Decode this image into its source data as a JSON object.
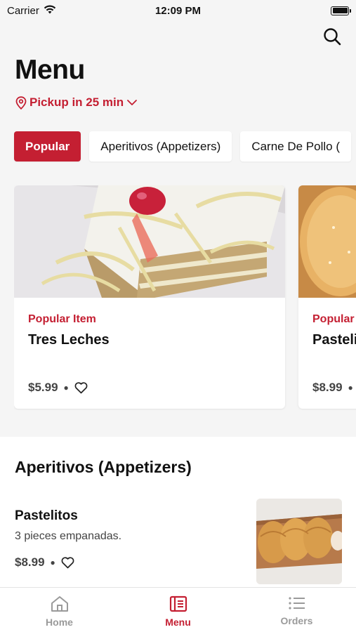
{
  "status_bar": {
    "carrier": "Carrier",
    "time": "12:09 PM"
  },
  "header": {
    "title": "Menu",
    "pickup": "Pickup in 25 min"
  },
  "tabs": [
    {
      "label": "Popular",
      "active": true
    },
    {
      "label": "Aperitivos (Appetizers)",
      "active": false
    },
    {
      "label": "Carne De Pollo (",
      "active": false
    }
  ],
  "popular_cards": [
    {
      "tag": "Popular Item",
      "name": "Tres Leches",
      "price": "$5.99"
    },
    {
      "tag": "Popular",
      "name": "Pasteli",
      "price": "$8.99"
    }
  ],
  "section": {
    "title": "Aperitivos (Appetizers)",
    "items": [
      {
        "name": "Pastelitos",
        "description": "3 pieces empanadas.",
        "price": "$8.99"
      }
    ]
  },
  "tabbar": [
    {
      "label": "Home",
      "icon": "home-icon",
      "active": false
    },
    {
      "label": "Menu",
      "icon": "menu-icon",
      "active": true
    },
    {
      "label": "Orders",
      "icon": "orders-icon",
      "active": false
    }
  ],
  "colors": {
    "accent": "#c41f32",
    "inactive": "#9a9a9a"
  }
}
